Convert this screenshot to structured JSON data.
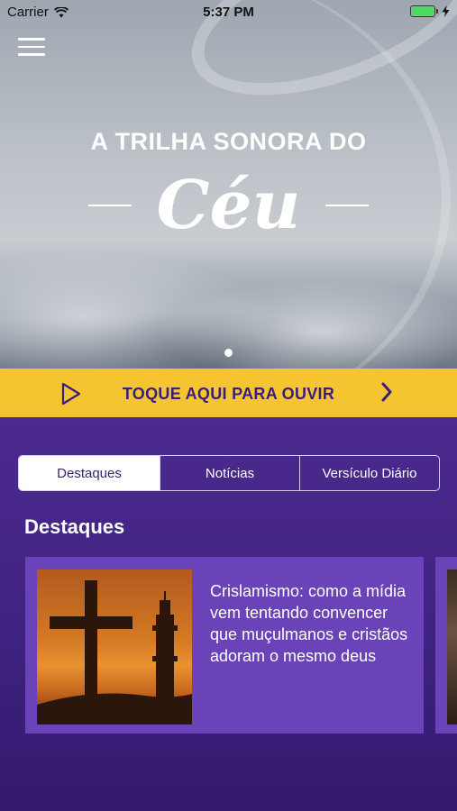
{
  "status_bar": {
    "carrier": "Carrier",
    "time": "5:37 PM"
  },
  "hero": {
    "title": "A TRILHA SONORA DO",
    "script": "Céu",
    "carousel": {
      "current": 1,
      "total": 1
    }
  },
  "listen_banner": {
    "label": "TOQUE AQUI PARA OUVIR"
  },
  "tabs": [
    {
      "label": "Destaques",
      "active": true
    },
    {
      "label": "Notícias",
      "active": false
    },
    {
      "label": "Versículo Diário",
      "active": false
    }
  ],
  "section": {
    "title": "Destaques"
  },
  "cards": [
    {
      "text": "Crislamismo: como a mídia vem tentando convencer que muçulmanos e cristãos adoram o mesmo deus"
    }
  ],
  "colors": {
    "brand_purple": "#3a1f7a",
    "card_purple": "#6b43b9",
    "accent_yellow": "#f5c531",
    "battery_green": "#4cd964"
  },
  "icons": [
    "wifi-icon",
    "battery-icon",
    "charging-icon",
    "menu-icon",
    "play-icon",
    "chevron-right-icon"
  ]
}
